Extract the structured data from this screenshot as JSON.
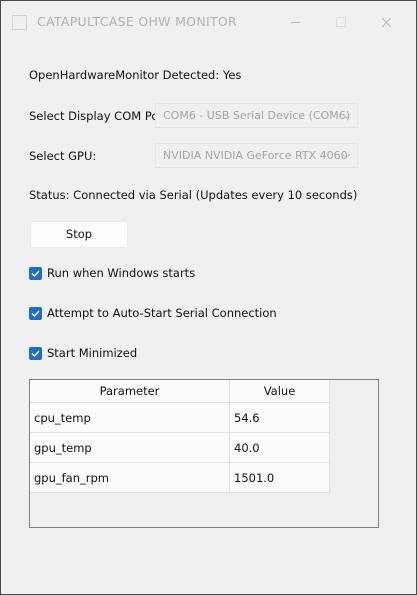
{
  "window": {
    "title": "CATAPULTCASE OHW MONITOR",
    "icons": {
      "app": "app-icon",
      "minimize": "minimize-icon",
      "maximize": "maximize-icon",
      "close": "close-icon"
    }
  },
  "ohm_detected": "OpenHardwareMonitor Detected: Yes",
  "com_port": {
    "label": "Select Display COM Port:",
    "value": "COM6 - USB Serial Device (COM6)"
  },
  "gpu": {
    "label": "Select GPU:",
    "value": "NVIDIA NVIDIA GeForce RTX 4060"
  },
  "status": "Status: Connected via Serial (Updates every 10 seconds)",
  "stop_button": "Stop",
  "options": [
    {
      "label": "Run when Windows starts",
      "checked": true
    },
    {
      "label": "Attempt to Auto-Start Serial Connection",
      "checked": true
    },
    {
      "label": "Start Minimized",
      "checked": true
    }
  ],
  "table": {
    "headers": [
      "Parameter",
      "Value"
    ],
    "rows": [
      {
        "parameter": "cpu_temp",
        "value": "54.6"
      },
      {
        "parameter": "gpu_temp",
        "value": "40.0"
      },
      {
        "parameter": "gpu_fan_rpm",
        "value": "1501.0"
      }
    ]
  },
  "colors": {
    "window_bg": "#f0f0f0",
    "checkbox_accent": "#1f6fc7",
    "disabled_text": "#a4a4a4",
    "title_text": "#b2b2b2"
  }
}
